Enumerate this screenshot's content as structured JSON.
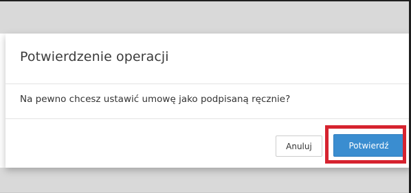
{
  "modal": {
    "title": "Potwierdzenie operacji",
    "message": "Na pewno chcesz ustawić umowę jako podpisaną ręcznie?",
    "cancel_label": "Anuluj",
    "confirm_label": "Potwierdź"
  },
  "colors": {
    "confirm_button": "#3a8dd0",
    "highlight": "#d6232f",
    "backdrop": "#d9d9d9"
  }
}
